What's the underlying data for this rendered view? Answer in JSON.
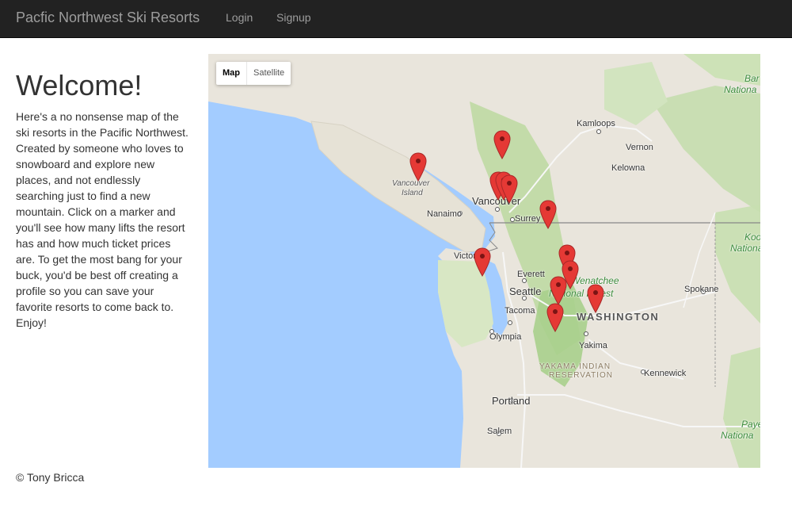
{
  "navbar": {
    "brand": "Pacfic Northwest Ski Resorts",
    "login": "Login",
    "signup": "Signup"
  },
  "main": {
    "heading": "Welcome!",
    "intro": "Here's a no nonsense map of the ski resorts in the Pacific Northwest. Created by someone who loves to snowboard and explore new places, and not endlessly searching just to find a new mountain. Click on a marker and you'll see how many lifts the resort has and how much ticket prices are. To get the most bang for your buck, you'd be best off creating a profile so you can save your favorite resorts to come back to. Enjoy!"
  },
  "map": {
    "type_buttons": {
      "map": "Map",
      "satellite": "Satellite"
    },
    "labels": {
      "kamloops": "Kamloops",
      "vernon": "Vernon",
      "kelowna": "Kelowna",
      "vancouver_island_1": "Vancouver",
      "vancouver_island_2": "Island",
      "vancouver": "Vancouver",
      "surrey": "Surrey",
      "nanaimo": "Nanaimo",
      "victoria": "Victoria",
      "everett": "Everett",
      "seattle": "Seattle",
      "tacoma": "Tacoma",
      "olympia": "Olympia",
      "spokane": "Spokane",
      "washington": "WASHINGTON",
      "yakima": "Yakima",
      "yakama_1": "YAKAMA INDIAN",
      "yakama_2": "RESERVATION",
      "kennewick": "Kennewick",
      "portland": "Portland",
      "salem": "Salem",
      "wenatchee": "Wenatchee",
      "national_forest": "National Forest",
      "banff_1": "Bar",
      "banff_2": "Nationa",
      "koot_1": "Koo",
      "koot_2": "Nationa",
      "payette_1": "Paye",
      "payette_2": "Nationa"
    },
    "marker_color": "#e53935"
  },
  "footer": {
    "copyright": "© Tony Bricca"
  },
  "colors": {
    "navbar_bg": "#222222",
    "navbar_text": "#9d9d9d",
    "water": "#a3ccff",
    "land": "#e9e5dc",
    "forest": "#b7d69a"
  }
}
